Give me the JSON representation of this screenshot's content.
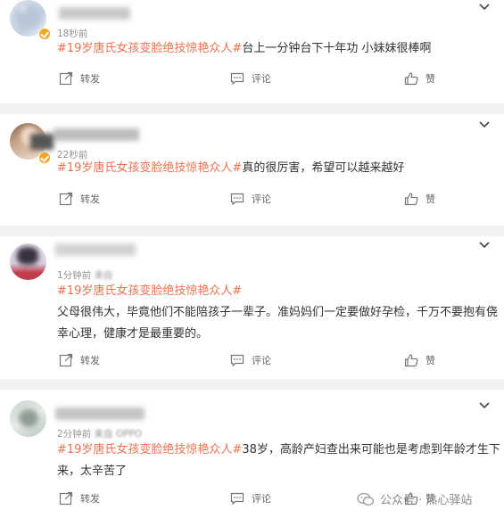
{
  "colors": {
    "tag": "#eb7350",
    "meta": "#939393",
    "divider": "#f2f2f2",
    "badge": "#f5a623"
  },
  "posts": [
    {
      "time": "18秒前",
      "tag": "#19岁唐氏女孩变脸绝技惊艳众人#",
      "text": "台上一分钟台下十年功 小妹妹很棒啊",
      "repost": "转发",
      "comment": "评论",
      "like": "赞"
    },
    {
      "time": "22秒前",
      "tag": "#19岁唐氏女孩变脸绝技惊艳众人#",
      "text": "真的很厉害，希望可以越来越好",
      "repost": "转发",
      "comment": "评论",
      "like": "赞"
    },
    {
      "time": "1分钟前",
      "source": "来自",
      "tag": "#19岁唐氏女孩变脸绝技惊艳众人#",
      "text_line1": "父母很伟大，毕竟他们不能陪孩子一辈子。准妈妈们一定要做好孕检，千万不要抱有侥",
      "text_line2": "幸心理，健康才是最重要的。",
      "repost": "转发",
      "comment": "评论",
      "like": "赞"
    },
    {
      "time": "2分钟前",
      "source": "来自 OPPO",
      "tag": "#19岁唐氏女孩变脸绝技惊艳众人#",
      "text_line1": "38岁，高龄产妇查出来可能也是考虑到年龄才生下",
      "text_line2": "来，太辛苦了",
      "repost": "转发",
      "comment": "评论",
      "like": "赞"
    }
  ],
  "watermark": {
    "text": "公众号 · 热心驿站",
    "icon": "wechat-icon"
  }
}
